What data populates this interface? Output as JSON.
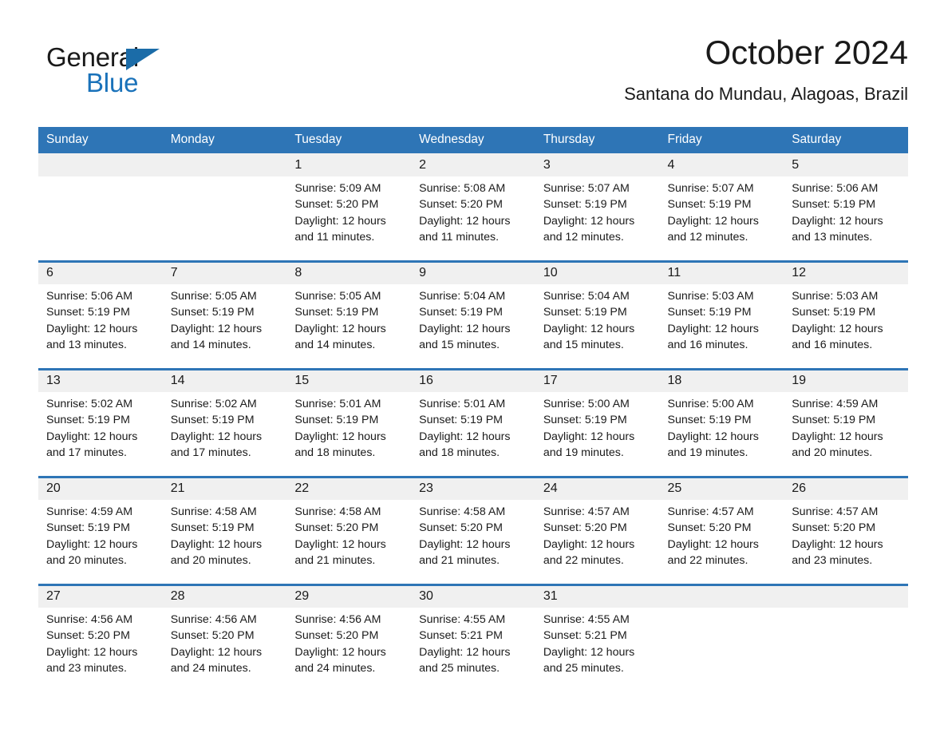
{
  "brand": {
    "name_dark": "General",
    "name_light": "Blue",
    "accent_color": "#2e75b6",
    "logo_icon": "triangle-flag-icon"
  },
  "header": {
    "title": "October 2024",
    "location": "Santana do Mundau, Alagoas, Brazil"
  },
  "calendar": {
    "weekday_headers": [
      "Sunday",
      "Monday",
      "Tuesday",
      "Wednesday",
      "Thursday",
      "Friday",
      "Saturday"
    ],
    "header_bg": "#2e75b6",
    "daynum_bg": "#f0f0f0",
    "weeks": [
      [
        {
          "day": "",
          "lines": []
        },
        {
          "day": "",
          "lines": []
        },
        {
          "day": "1",
          "lines": [
            "Sunrise: 5:09 AM",
            "Sunset: 5:20 PM",
            "Daylight: 12 hours",
            "and 11 minutes."
          ]
        },
        {
          "day": "2",
          "lines": [
            "Sunrise: 5:08 AM",
            "Sunset: 5:20 PM",
            "Daylight: 12 hours",
            "and 11 minutes."
          ]
        },
        {
          "day": "3",
          "lines": [
            "Sunrise: 5:07 AM",
            "Sunset: 5:19 PM",
            "Daylight: 12 hours",
            "and 12 minutes."
          ]
        },
        {
          "day": "4",
          "lines": [
            "Sunrise: 5:07 AM",
            "Sunset: 5:19 PM",
            "Daylight: 12 hours",
            "and 12 minutes."
          ]
        },
        {
          "day": "5",
          "lines": [
            "Sunrise: 5:06 AM",
            "Sunset: 5:19 PM",
            "Daylight: 12 hours",
            "and 13 minutes."
          ]
        }
      ],
      [
        {
          "day": "6",
          "lines": [
            "Sunrise: 5:06 AM",
            "Sunset: 5:19 PM",
            "Daylight: 12 hours",
            "and 13 minutes."
          ]
        },
        {
          "day": "7",
          "lines": [
            "Sunrise: 5:05 AM",
            "Sunset: 5:19 PM",
            "Daylight: 12 hours",
            "and 14 minutes."
          ]
        },
        {
          "day": "8",
          "lines": [
            "Sunrise: 5:05 AM",
            "Sunset: 5:19 PM",
            "Daylight: 12 hours",
            "and 14 minutes."
          ]
        },
        {
          "day": "9",
          "lines": [
            "Sunrise: 5:04 AM",
            "Sunset: 5:19 PM",
            "Daylight: 12 hours",
            "and 15 minutes."
          ]
        },
        {
          "day": "10",
          "lines": [
            "Sunrise: 5:04 AM",
            "Sunset: 5:19 PM",
            "Daylight: 12 hours",
            "and 15 minutes."
          ]
        },
        {
          "day": "11",
          "lines": [
            "Sunrise: 5:03 AM",
            "Sunset: 5:19 PM",
            "Daylight: 12 hours",
            "and 16 minutes."
          ]
        },
        {
          "day": "12",
          "lines": [
            "Sunrise: 5:03 AM",
            "Sunset: 5:19 PM",
            "Daylight: 12 hours",
            "and 16 minutes."
          ]
        }
      ],
      [
        {
          "day": "13",
          "lines": [
            "Sunrise: 5:02 AM",
            "Sunset: 5:19 PM",
            "Daylight: 12 hours",
            "and 17 minutes."
          ]
        },
        {
          "day": "14",
          "lines": [
            "Sunrise: 5:02 AM",
            "Sunset: 5:19 PM",
            "Daylight: 12 hours",
            "and 17 minutes."
          ]
        },
        {
          "day": "15",
          "lines": [
            "Sunrise: 5:01 AM",
            "Sunset: 5:19 PM",
            "Daylight: 12 hours",
            "and 18 minutes."
          ]
        },
        {
          "day": "16",
          "lines": [
            "Sunrise: 5:01 AM",
            "Sunset: 5:19 PM",
            "Daylight: 12 hours",
            "and 18 minutes."
          ]
        },
        {
          "day": "17",
          "lines": [
            "Sunrise: 5:00 AM",
            "Sunset: 5:19 PM",
            "Daylight: 12 hours",
            "and 19 minutes."
          ]
        },
        {
          "day": "18",
          "lines": [
            "Sunrise: 5:00 AM",
            "Sunset: 5:19 PM",
            "Daylight: 12 hours",
            "and 19 minutes."
          ]
        },
        {
          "day": "19",
          "lines": [
            "Sunrise: 4:59 AM",
            "Sunset: 5:19 PM",
            "Daylight: 12 hours",
            "and 20 minutes."
          ]
        }
      ],
      [
        {
          "day": "20",
          "lines": [
            "Sunrise: 4:59 AM",
            "Sunset: 5:19 PM",
            "Daylight: 12 hours",
            "and 20 minutes."
          ]
        },
        {
          "day": "21",
          "lines": [
            "Sunrise: 4:58 AM",
            "Sunset: 5:19 PM",
            "Daylight: 12 hours",
            "and 20 minutes."
          ]
        },
        {
          "day": "22",
          "lines": [
            "Sunrise: 4:58 AM",
            "Sunset: 5:20 PM",
            "Daylight: 12 hours",
            "and 21 minutes."
          ]
        },
        {
          "day": "23",
          "lines": [
            "Sunrise: 4:58 AM",
            "Sunset: 5:20 PM",
            "Daylight: 12 hours",
            "and 21 minutes."
          ]
        },
        {
          "day": "24",
          "lines": [
            "Sunrise: 4:57 AM",
            "Sunset: 5:20 PM",
            "Daylight: 12 hours",
            "and 22 minutes."
          ]
        },
        {
          "day": "25",
          "lines": [
            "Sunrise: 4:57 AM",
            "Sunset: 5:20 PM",
            "Daylight: 12 hours",
            "and 22 minutes."
          ]
        },
        {
          "day": "26",
          "lines": [
            "Sunrise: 4:57 AM",
            "Sunset: 5:20 PM",
            "Daylight: 12 hours",
            "and 23 minutes."
          ]
        }
      ],
      [
        {
          "day": "27",
          "lines": [
            "Sunrise: 4:56 AM",
            "Sunset: 5:20 PM",
            "Daylight: 12 hours",
            "and 23 minutes."
          ]
        },
        {
          "day": "28",
          "lines": [
            "Sunrise: 4:56 AM",
            "Sunset: 5:20 PM",
            "Daylight: 12 hours",
            "and 24 minutes."
          ]
        },
        {
          "day": "29",
          "lines": [
            "Sunrise: 4:56 AM",
            "Sunset: 5:20 PM",
            "Daylight: 12 hours",
            "and 24 minutes."
          ]
        },
        {
          "day": "30",
          "lines": [
            "Sunrise: 4:55 AM",
            "Sunset: 5:21 PM",
            "Daylight: 12 hours",
            "and 25 minutes."
          ]
        },
        {
          "day": "31",
          "lines": [
            "Sunrise: 4:55 AM",
            "Sunset: 5:21 PM",
            "Daylight: 12 hours",
            "and 25 minutes."
          ]
        },
        {
          "day": "",
          "lines": []
        },
        {
          "day": "",
          "lines": []
        }
      ]
    ]
  }
}
